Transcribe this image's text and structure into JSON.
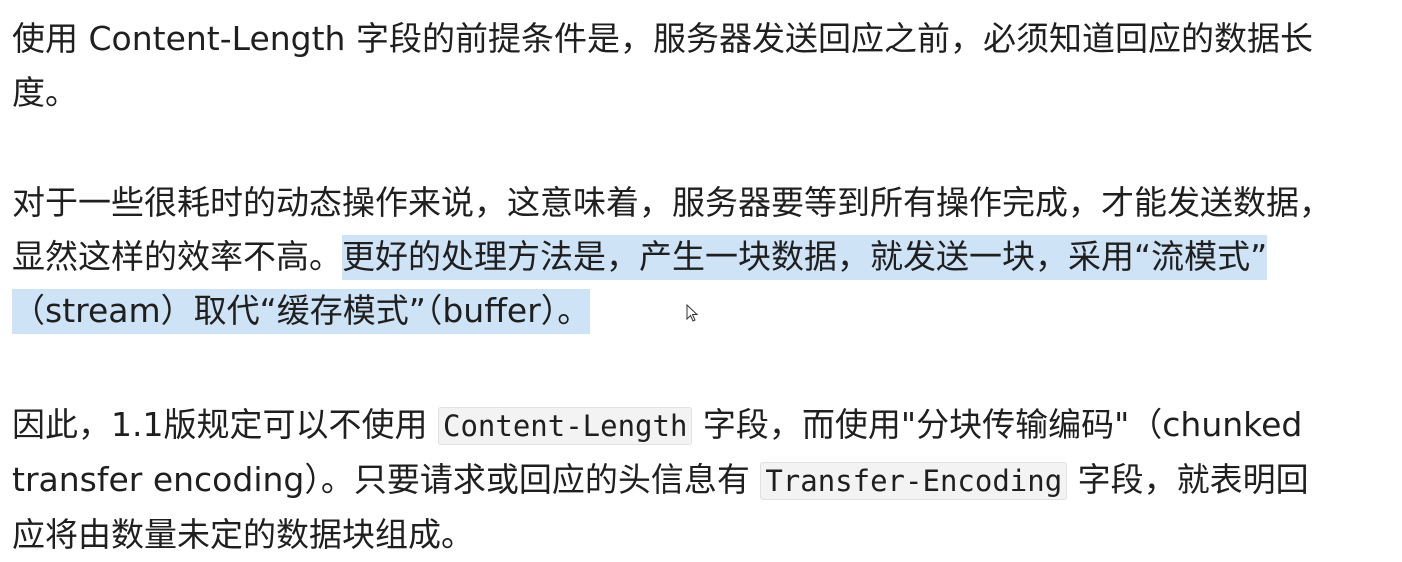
{
  "paragraph1": {
    "line1": "使用 Content-Length 字段的前提条件是，服务器发送回应之前，必须知道回应的数据长",
    "line2": "度。"
  },
  "paragraph2": {
    "line1": "对于一些很耗时的动态操作来说，这意味着，服务器要等到所有操作完成，才能发送数据，",
    "line2_plain": "显然这样的效率不高。",
    "line2_selected": "更好的处理方法是，产生一块数据，就发送一块，采用“流模式”",
    "line3_selected": "（stream）取代“缓存模式”（buffer）。"
  },
  "paragraph3": {
    "line1_a": "因此，1.1版规定可以不使用 ",
    "code1": "Content-Length",
    "line1_b": " 字段，而使用\"分块传输编码\"（chunked",
    "line2_a": "transfer encoding）。只要请求或回应的头信息有 ",
    "code2": "Transfer-Encoding",
    "line2_b": " 字段，就表明回",
    "line3": "应将由数量未定的数据块组成。"
  },
  "colors": {
    "text": "#1f1f1f",
    "selection": "#cfe3f7",
    "code_background": "#f3f3f3"
  },
  "icons": {
    "cursor": "mouse-pointer-icon"
  }
}
